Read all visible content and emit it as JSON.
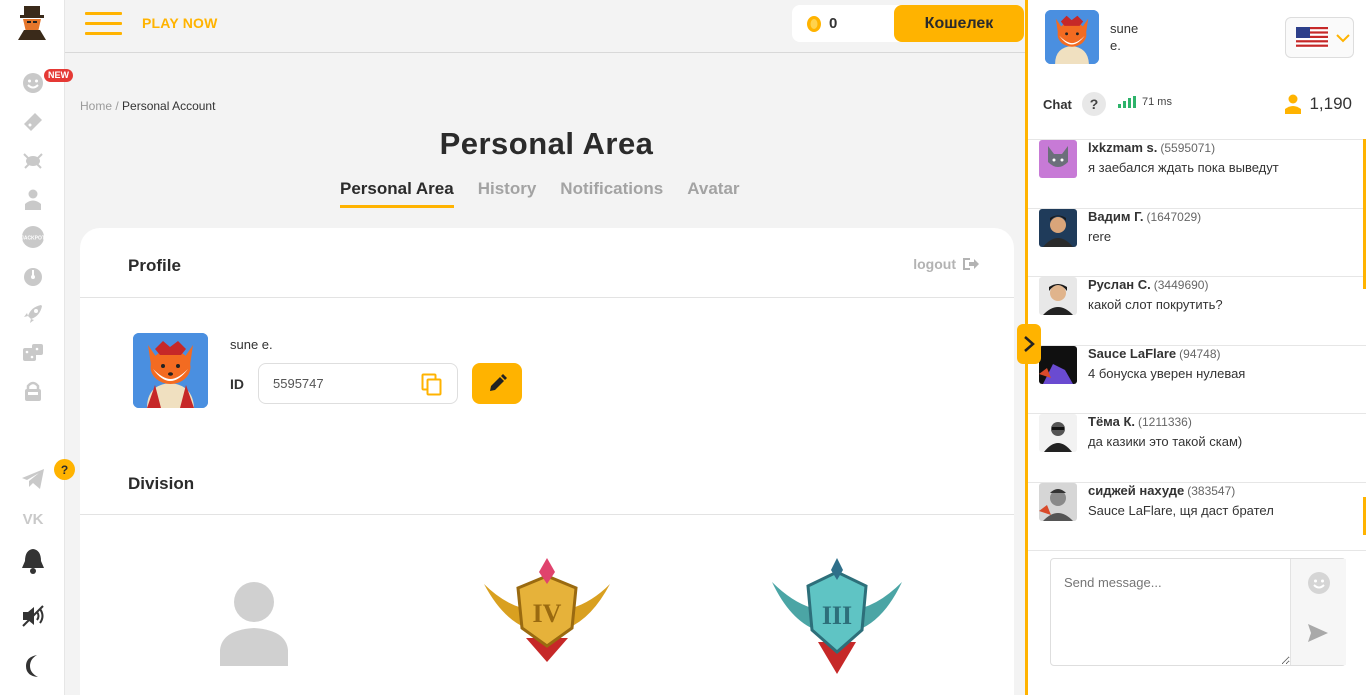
{
  "header": {
    "menu_label": "PLAY NOW",
    "wallet_balance": "0",
    "wallet_button": "Кошелек"
  },
  "sidebar": {
    "new_badge": "NEW",
    "help_badge": "?"
  },
  "breadcrumb": {
    "home": "Home /",
    "current": "Personal Account"
  },
  "page": {
    "title": "Personal Area",
    "tabs": [
      "Personal Area",
      "History",
      "Notifications",
      "Avatar"
    ]
  },
  "profile": {
    "heading": "Profile",
    "logout": "logout",
    "username": "sune e.",
    "id_label": "ID",
    "id_value": "5595747"
  },
  "division": {
    "heading": "Division"
  },
  "chat": {
    "user_first": "sune",
    "user_last": "e.",
    "label": "Chat",
    "help": "?",
    "ping": "71 ms",
    "online": "1,190",
    "placeholder": "Send message...",
    "messages": [
      {
        "name": "lxkzmam s.",
        "uid": "(5595071)",
        "text": "я заебался ждать пока выведут"
      },
      {
        "name": "Вадим Г.",
        "uid": "(1647029)",
        "text": "rere"
      },
      {
        "name": "Руслан С.",
        "uid": "(3449690)",
        "text": "какой слот покрутить?"
      },
      {
        "name": "Sauce LaFlare",
        "uid": "(94748)",
        "text": "4 бонуска уверен нулевая"
      },
      {
        "name": "Тёма К.",
        "uid": "(1211336)",
        "text": "да казики это такой скам)"
      },
      {
        "name": "сиджей нахуде",
        "uid": "(383547)",
        "text": "Sauce LaFlare, щя даст брател"
      }
    ]
  },
  "colors": {
    "accent": "#ffb300",
    "text": "#2b2b2b",
    "muted": "#a3a3a3"
  }
}
